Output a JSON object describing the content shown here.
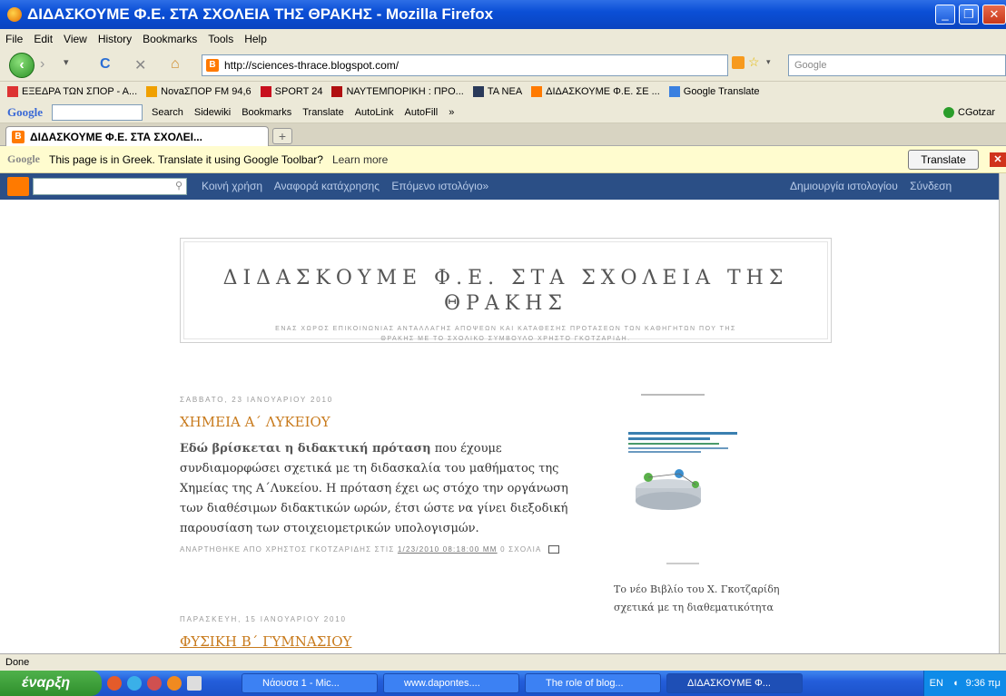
{
  "window": {
    "title": "ΔΙΔΑΣΚΟΥΜΕ Φ.Ε. ΣΤΑ ΣΧΟΛΕΙΑ ΤΗΣ ΘΡΑΚΗΣ - Mozilla Firefox"
  },
  "menu": [
    "File",
    "Edit",
    "View",
    "History",
    "Bookmarks",
    "Tools",
    "Help"
  ],
  "nav": {
    "url": "http://sciences-thrace.blogspot.com/",
    "search_placeholder": "Google"
  },
  "bookmarks": [
    {
      "label": "ΕΞΕΔΡΑ ΤΩΝ ΣΠΟΡ - Α...",
      "color": "#d33"
    },
    {
      "label": "NovaΣΠΟΡ FM 94,6",
      "color": "#f0a000"
    },
    {
      "label": "SPORT 24",
      "color": "#c8101e"
    },
    {
      "label": "ΝΑΥΤΕΜΠΟΡΙΚΗ : ΠΡΟ...",
      "color": "#b01010"
    },
    {
      "label": "ΤΑ ΝΕΑ",
      "color": "#2a3a5a"
    },
    {
      "label": "ΔΙΔΑΣΚΟΥΜΕ Φ.Ε. ΣΕ ...",
      "color": "#ff7a00"
    },
    {
      "label": "Google Translate",
      "color": "#3a80e0"
    }
  ],
  "gtoolbar": {
    "logo": "Google",
    "items": [
      "Search",
      "Sidewiki",
      "Bookmarks",
      "Translate",
      "AutoLink",
      "AutoFill",
      "»"
    ],
    "user": "CGotzar"
  },
  "tab": {
    "label": "ΔΙΔΑΣΚΟΥΜΕ Φ.Ε. ΣΤΑ ΣΧΟΛΕΙ...",
    "new": "+"
  },
  "translate": {
    "logo": "Google",
    "message": "This page is in Greek. Translate it using Google Toolbar?",
    "learn_more": "Learn more",
    "button": "Translate"
  },
  "blogger": {
    "links": [
      "Κοινή χρήση",
      "Αναφορά κατάχρησης",
      "Επόμενο ιστολόγιο»"
    ],
    "create": "Δημιουργία ιστολογίου",
    "signin": "Σύνδεση"
  },
  "blog": {
    "title": "ΔΙΔΑΣΚΟΥΜΕ Φ.Ε. ΣΤΑ ΣΧΟΛΕΙΑ ΤΗΣ ΘΡΑΚΗΣ",
    "description": "ΕΝΑΣ ΧΩΡΟΣ ΕΠΙΚΟΙΝΩΝΙΑΣ ΑΝΤΑΛΛΑΓΗΣ ΑΠΟΨΕΩΝ ΚΑΙ ΚΑΤΑΘΕΣΗΣ ΠΡΟΤΑΣΕΩΝ ΤΩΝ ΚΑΘΗΓΗΤΩΝ ΠΟΥ ΤΗΣ ΘΡΑΚΗΣ ΜΕ ΤΟ ΣΧΟΛΙΚΟ ΣΥΜΒΟΥΛΟ ΧΡΗΣΤΟ ΓΚΟΤΖΑΡΙΔΗ."
  },
  "post1": {
    "date": "ΣΑΒΒΑΤΟ, 23 ΙΑΝΟΥΑΡΙΟΥ 2010",
    "title": "ΧΗΜΕΙΑ Α΄ ΛΥΚΕΙΟΥ",
    "body_bold": "Εδώ βρίσκεται η διδακτική πρόταση",
    "body_rest": " που έχουμε συνδιαμορφώσει σχετικά με τη διδασκαλία του μαθήματος της Χημείας της Α΄Λυκείου. Η πρόταση έχει ως στόχο την οργάνωση των διαθέσιμων διδακτικών ωρών, έτσι ώστε να γίνει διεξοδική παρουσίαση των στοιχειομετρικών υπολογισμών.",
    "footer_prefix": "ΑΝΑΡΤΗΘΗΚΕ ΑΠΟ ΧΡΗΣΤΟΣ ΓΚΟΤΖΑΡΙΔΗΣ ΣΤΙΣ",
    "footer_time": "1/23/2010 08:18:00 ΜΜ",
    "comments": "0 ΣΧΟΛΙΑ"
  },
  "post2": {
    "date": "ΠΑΡΑΣΚΕΥΗ, 15 ΙΑΝΟΥΑΡΙΟΥ 2010",
    "title": "ΦΥΣΙΚΗ Β΄ ΓΥΜΝΑΣΙΟΥ"
  },
  "sidebar": {
    "caption": "Το νέο Βιβλίο του Χ. Γκοτζαρίδη σχετικά με τη διαθεματικότητα"
  },
  "status": "Done",
  "taskbar": {
    "start": "έναρξη",
    "buttons": [
      "Νάουσα 1 - Mic...",
      "www.dapontes....",
      "The role of blog...",
      "ΔΙΔΑΣΚΟΥΜΕ Φ..."
    ],
    "lang": "EN",
    "clock": "9:36 πμ"
  }
}
